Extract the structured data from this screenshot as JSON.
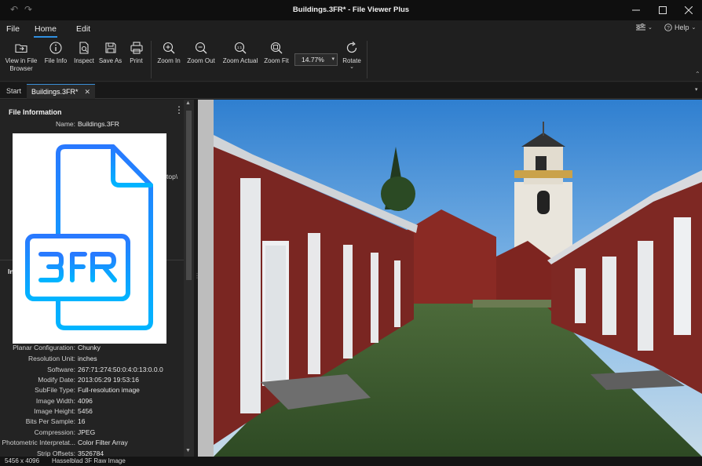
{
  "window": {
    "title": "Buildings.3FR* - File Viewer Plus",
    "back_glyph": "↶",
    "forward_glyph": "↷"
  },
  "menu": {
    "items": [
      "File",
      "Home",
      "Edit"
    ],
    "active": "Home",
    "help_label": "Help"
  },
  "ribbon": {
    "view_in_file_browser": "View in File Browser",
    "view_line1": "View in File",
    "view_line2": "Browser",
    "file_info": "File Info",
    "inspect": "Inspect",
    "save_as": "Save As",
    "print": "Print",
    "zoom_in": "Zoom In",
    "zoom_out": "Zoom Out",
    "zoom_actual": "Zoom Actual",
    "zoom_fit": "Zoom Fit",
    "zoom_level": "14.77%",
    "rotate": "Rotate"
  },
  "tabs": {
    "start": "Start",
    "file": "Buildings.3FR*"
  },
  "panel": {
    "heading": "File Information",
    "name_key": "Name:",
    "name_value": "Buildings.3FR",
    "path_fragment": "top\\",
    "section_fragment": "In",
    "rows": [
      {
        "key": "Planar Configuration:",
        "value": "Chunky"
      },
      {
        "key": "Resolution Unit:",
        "value": "inches"
      },
      {
        "key": "Software:",
        "value": "267:71:274:50:0:4:0:13:0.0.0"
      },
      {
        "key": "Modify Date:",
        "value": "2013:05:29 19:53:16"
      },
      {
        "key": "SubFile Type:",
        "value": "Full-resolution image"
      },
      {
        "key": "Image Width:",
        "value": "4096"
      },
      {
        "key": "Image Height:",
        "value": "5456"
      },
      {
        "key": "Bits Per Sample:",
        "value": "16"
      },
      {
        "key": "Compression:",
        "value": "JPEG"
      },
      {
        "key": "Photometric Interpretat...",
        "value": "Color Filter Array"
      },
      {
        "key": "Strip Offsets:",
        "value": "3526784"
      }
    ],
    "file_icon_text": "3FR"
  },
  "status": {
    "dimensions": "5456 x 4096",
    "format": "Hasselblad 3F Raw Image"
  },
  "colors": {
    "accent": "#2f8fe0",
    "icon_blue_top": "#2979ff",
    "icon_blue_bottom": "#00b4ff"
  }
}
